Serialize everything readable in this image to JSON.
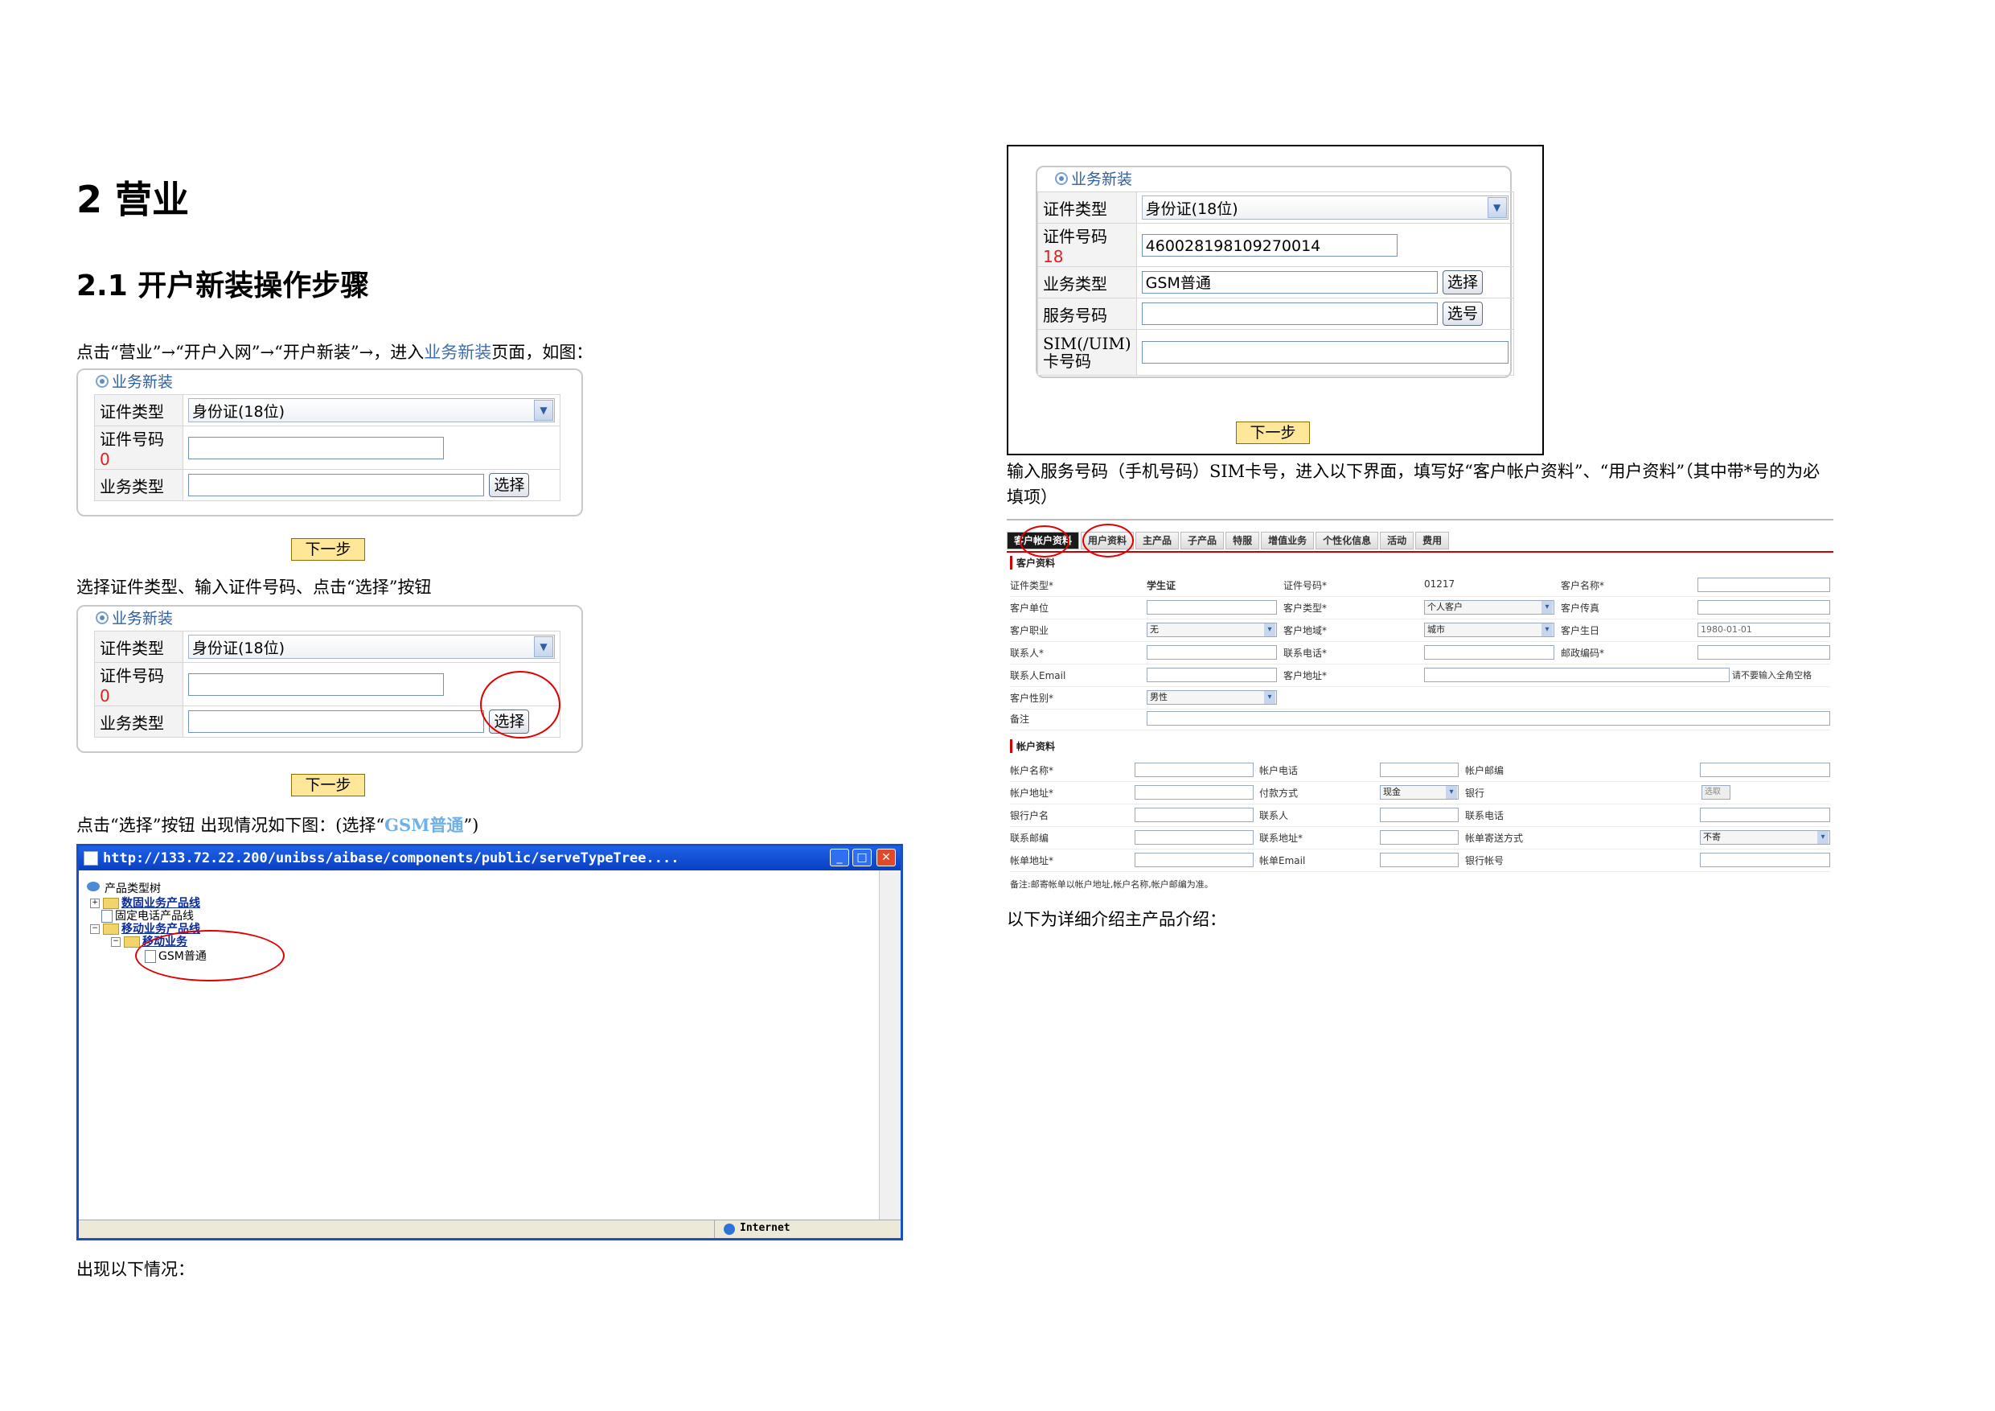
{
  "heading1": "2 营业",
  "heading2": "2.1 开户新装操作步骤",
  "para1_a": "点击“营业”→“开户入网”→“开户新装”→，进入",
  "para1_link": "业务新装",
  "para1_b": "页面，如图：",
  "para2": "选择证件类型、输入证件号码、点击“选择”按钮",
  "para3_a": "点击“选择”按钮 出现情况如下图：(选择“",
  "para3_gsm": "GSM普通",
  "para3_b": "”)",
  "para4": "出现以下情况：",
  "para5_line1": "输入服务号码（手机号码）SIM卡号，进入以下界面，填写好“客户帐户资料”、“用户资料”（其中带*号的为必",
  "para5_line2": "填项）",
  "para6": "以下为详细介绍主产品介绍：",
  "form": {
    "title": "业务新装",
    "cert_type_label": "证件类型",
    "cert_type_value": "身份证(18位)",
    "cert_no_label": "证件号码",
    "cert_no_count_1": "0",
    "cert_no_count_2": "0",
    "cert_no_count_3": "18",
    "cert_no_value": "460028198109270014",
    "biz_type_label": "业务类型",
    "biz_type_value": "GSM普通",
    "select_btn": "选择",
    "service_no_label": "服务号码",
    "pick_no_btn": "选号",
    "sim_label_1": "SIM(/UIM)",
    "sim_label_2": "卡号码",
    "next_btn": "下一步"
  },
  "browser": {
    "url": "http://133.72.22.200/unibss/aibase/components/public/serveTypeTree....",
    "status_zone": "Internet",
    "tree": {
      "root": "产品类型树",
      "n1": "数固业务产品线",
      "n2": "固定电话产品线",
      "n3": "移动业务产品线",
      "n4": "移动业务",
      "n5": "GSM普通"
    }
  },
  "bigform": {
    "tabs": [
      "客户帐户资料",
      "用户资料",
      "主产品",
      "子产品",
      "特服",
      "增值业务",
      "个性化信息",
      "活动",
      "费用"
    ],
    "sec_customer": "客户资料",
    "sec_account": "帐户资料",
    "c_cert_type": "证件类型*",
    "c_cert_type_val": "学生证",
    "c_cert_no": "证件号码*",
    "c_cert_no_val": "01217",
    "c_name": "客户名称*",
    "c_unit": "客户单位",
    "c_type": "客户类型*",
    "c_type_val": "个人客户",
    "c_fax": "客户传真",
    "c_job": "客户职业",
    "c_job_val": "无",
    "c_region": "客户地域*",
    "c_region_val": "城市",
    "c_birth": "客户生日",
    "c_birth_val": "1980-01-01",
    "c_contact": "联系人*",
    "c_phone": "联系电话*",
    "c_zip": "邮政编码*",
    "c_email": "联系人Email",
    "c_addr": "客户地址*",
    "c_addr_hint": "请不要输入全角空格",
    "c_gender": "客户性别*",
    "c_gender_val": "男性",
    "c_note": "备注",
    "a_name": "帐户名称*",
    "a_phone": "帐户电话",
    "a_mail": "帐户邮编",
    "a_addr": "帐户地址*",
    "a_pay": "付款方式",
    "a_pay_val": "现金",
    "a_bank": "银行",
    "a_bank_btn": "选取",
    "a_bank_owner": "银行户名",
    "a_contact": "联系人",
    "a_contact_phone": "联系电话",
    "a_contact_mail": "联系邮编",
    "a_contact_addr": "联系地址*",
    "a_bill_send": "帐单寄送方式",
    "a_bill_send_val": "不寄",
    "a_bill_addr": "帐单地址*",
    "a_bill_email": "帐单Email",
    "a_bank_acct": "银行帐号",
    "a_note": "备注:邮寄帐单以帐户地址,帐户名称,帐户邮编为准。"
  }
}
